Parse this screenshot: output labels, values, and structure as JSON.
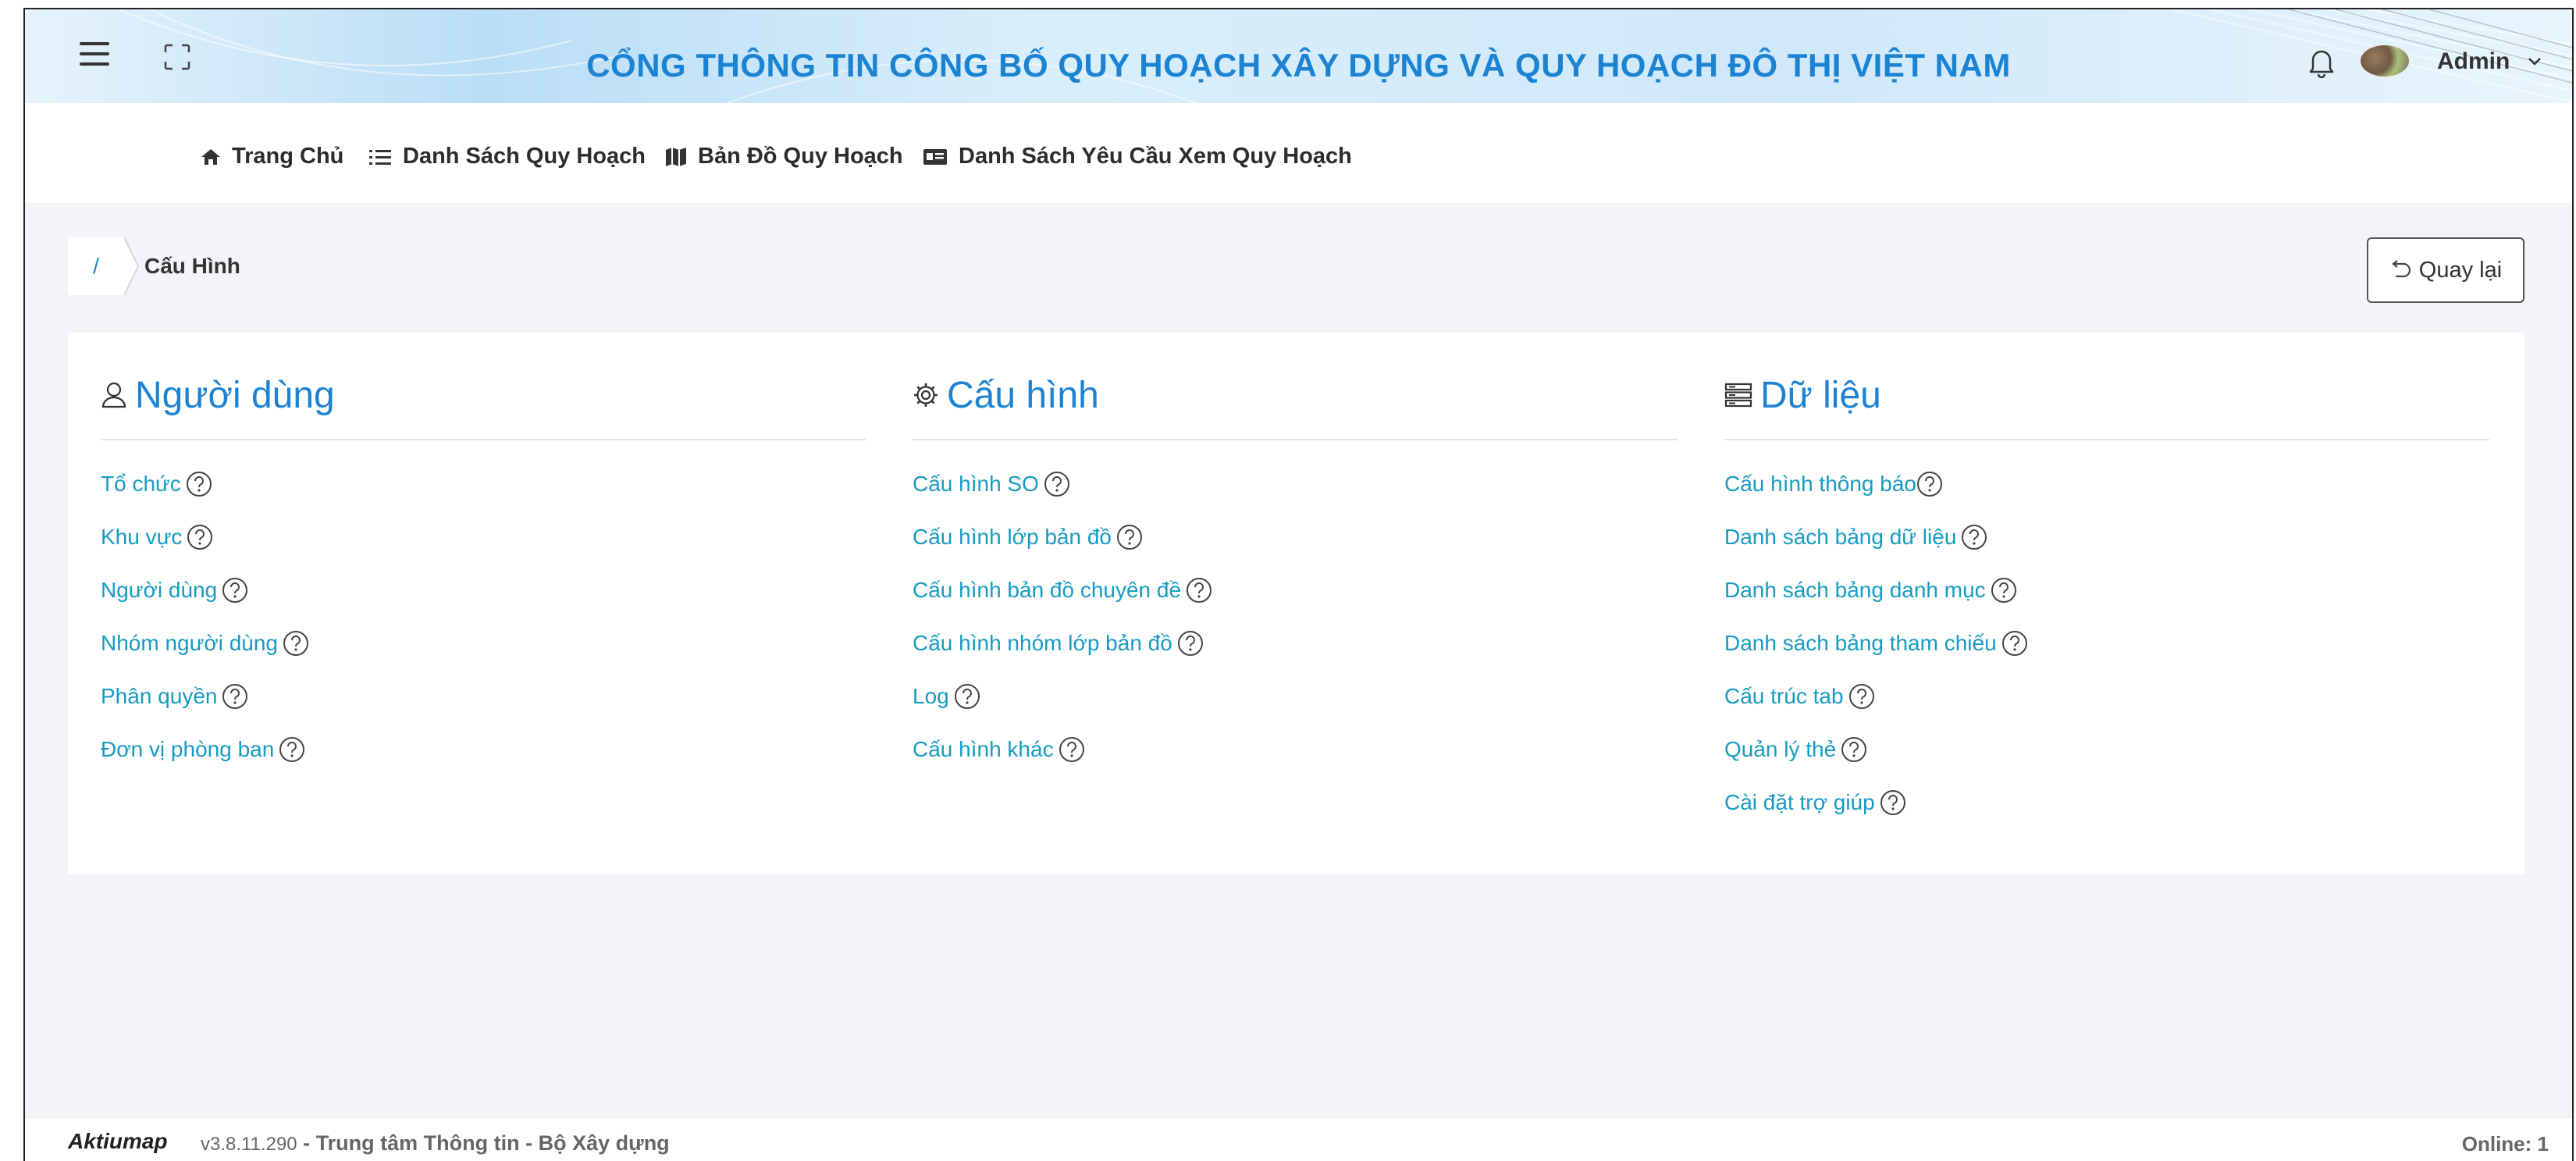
{
  "header": {
    "title": "CỔNG THÔNG TIN CÔNG BỐ QUY HOẠCH XÂY DỰNG VÀ QUY HOẠCH ĐÔ THỊ VIỆT NAM",
    "user_name": "Admin",
    "menu_icon": "hamburger-icon",
    "fullscreen_icon": "fullscreen-icon",
    "notification_icon": "bell-icon"
  },
  "nav": {
    "items": [
      {
        "label": "Trang Chủ",
        "icon": "home-icon"
      },
      {
        "label": "Danh Sách Quy Hoạch",
        "icon": "list-icon"
      },
      {
        "label": "Bản Đồ Quy Hoạch",
        "icon": "map-icon"
      },
      {
        "label": "Danh Sách Yêu Cầu Xem Quy Hoạch",
        "icon": "id-card-icon"
      }
    ]
  },
  "breadcrumb": {
    "root": "/",
    "current": "Cấu Hình"
  },
  "back_button": {
    "label": "Quay lại",
    "icon": "return-icon"
  },
  "sections": [
    {
      "title": "Người dùng",
      "icon": "user-icon",
      "links": [
        "Tổ chức",
        "Khu vực",
        "Người dùng",
        "Nhóm người dùng",
        "Phân quyền",
        "Đơn vị phòng ban"
      ]
    },
    {
      "title": "Cấu hình",
      "icon": "gear-icon",
      "links": [
        "Cấu hình SO",
        "Cấu hình lớp bản đồ",
        "Cấu hình bản đồ chuyên đề",
        "Cấu hình nhóm lớp bản đồ",
        "Log",
        "Cấu hình khác"
      ]
    },
    {
      "title": "Dữ liệu",
      "icon": "database-icon",
      "links": [
        "Cấu hình thông báo",
        "Danh sách bảng dữ liệu",
        "Danh sách bảng danh mục",
        "Danh sách bảng tham chiếu",
        "Cấu trúc tab",
        "Quản lý thẻ",
        "Cài đặt trợ giúp"
      ]
    }
  ],
  "footer": {
    "logo": "Aktiumap",
    "version": "v3.8.11.290",
    "org": "- Trung tâm Thông tin - Bộ Xây dựng",
    "online": "Online: 1"
  },
  "colors": {
    "accent": "#1c83d3",
    "link": "#179bc2",
    "background": "#f3f4f8"
  }
}
